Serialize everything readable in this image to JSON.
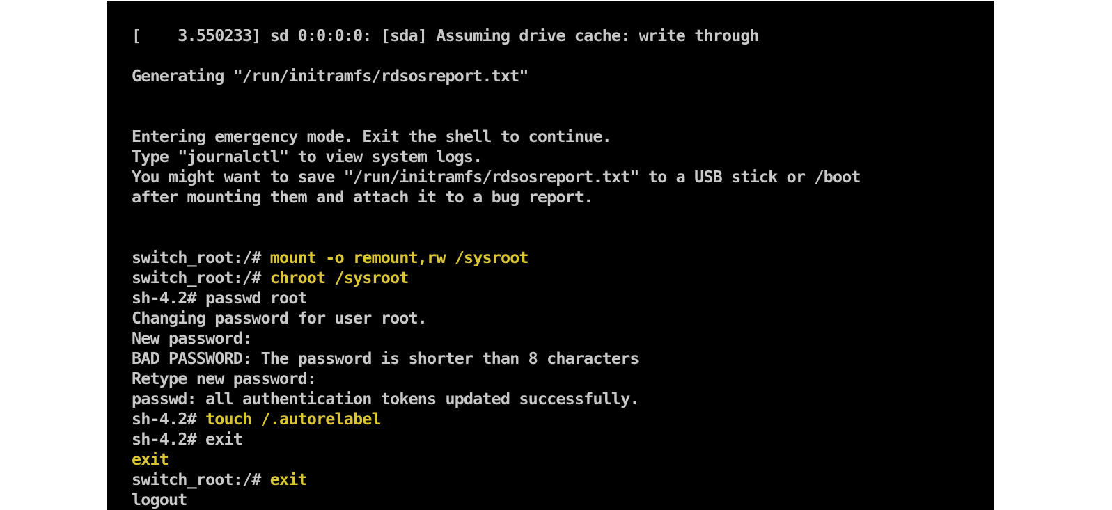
{
  "console": {
    "colors": {
      "background": "#000000",
      "text": "#c8c8c8",
      "typed_command": "#d9c536"
    },
    "lines": [
      {
        "text": "[    3.550233] sd 0:0:0:0: [sda] Assuming drive cache: write through"
      },
      {
        "text": ""
      },
      {
        "text": "Generating \"/run/initramfs/rdsosreport.txt\""
      },
      {
        "text": ""
      },
      {
        "text": ""
      },
      {
        "text": "Entering emergency mode. Exit the shell to continue."
      },
      {
        "text": "Type \"journalctl\" to view system logs."
      },
      {
        "text": "You might want to save \"/run/initramfs/rdsosreport.txt\" to a USB stick or /boot"
      },
      {
        "text": "after mounting them and attach it to a bug report."
      },
      {
        "text": ""
      },
      {
        "text": ""
      },
      {
        "prompt": "switch_root:/# ",
        "command": "mount -o remount,rw /sysroot"
      },
      {
        "prompt": "switch_root:/# ",
        "command": "chroot /sysroot"
      },
      {
        "prompt": "sh-4.2# ",
        "plain_command": "passwd root"
      },
      {
        "text": "Changing password for user root."
      },
      {
        "text": "New password:"
      },
      {
        "text": "BAD PASSWORD: The password is shorter than 8 characters"
      },
      {
        "text": "Retype new password:"
      },
      {
        "text": "passwd: all authentication tokens updated successfully."
      },
      {
        "prompt": "sh-4.2# ",
        "command": "touch /.autorelabel"
      },
      {
        "prompt": "sh-4.2# ",
        "plain_command": "exit"
      },
      {
        "echo": "exit"
      },
      {
        "prompt": "switch_root:/# ",
        "command": "exit"
      },
      {
        "text": "logout"
      }
    ]
  }
}
